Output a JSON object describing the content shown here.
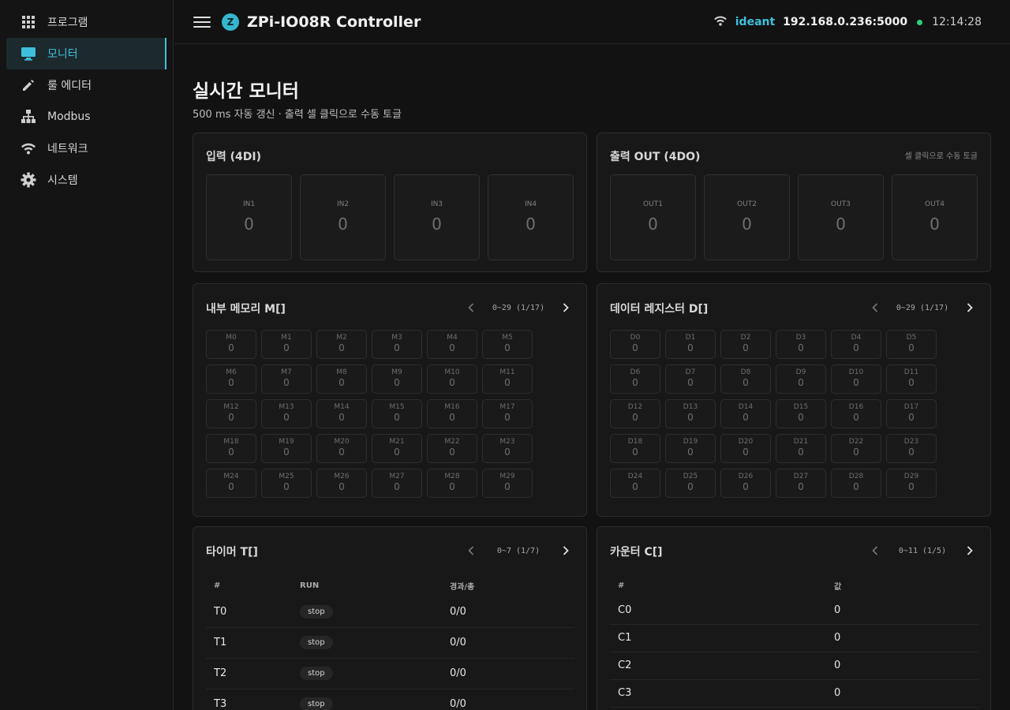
{
  "sidebar": {
    "items": [
      {
        "label": "프로그램",
        "icon": "apps-grid-icon"
      },
      {
        "label": "모니터",
        "icon": "monitor-icon",
        "active": true
      },
      {
        "label": "룰 에디터",
        "icon": "pencil-icon"
      },
      {
        "label": "Modbus",
        "icon": "network-tree-icon"
      },
      {
        "label": "네트워크",
        "icon": "wifi-icon"
      },
      {
        "label": "시스템",
        "icon": "gear-icon"
      }
    ]
  },
  "header": {
    "logo_letter": "Z",
    "title": "ZPi-IO08R Controller",
    "user": "ideant",
    "address": "192.168.0.236:5000",
    "time": "12:14:28",
    "status_color": "#2ed27a",
    "accent": "#3ec0dc"
  },
  "page": {
    "title": "실시간 모니터",
    "subtitle": "500 ms 자동 갱신 · 출력 셀 클릭으로 수동 토글"
  },
  "inputs": {
    "title": "입력 (4DI)",
    "cells": [
      {
        "label": "IN1",
        "value": "0"
      },
      {
        "label": "IN2",
        "value": "0"
      },
      {
        "label": "IN3",
        "value": "0"
      },
      {
        "label": "IN4",
        "value": "0"
      }
    ]
  },
  "outputs": {
    "title": "출력 OUT (4DO)",
    "hint": "셀 클릭으로 수동 토글",
    "cells": [
      {
        "label": "OUT1",
        "value": "0"
      },
      {
        "label": "OUT2",
        "value": "0"
      },
      {
        "label": "OUT3",
        "value": "0"
      },
      {
        "label": "OUT4",
        "value": "0"
      }
    ]
  },
  "memory": {
    "title": "내부 메모리 M[]",
    "range": "0~29 (1/17)",
    "cells": [
      {
        "label": "M0",
        "value": "0"
      },
      {
        "label": "M1",
        "value": "0"
      },
      {
        "label": "M2",
        "value": "0"
      },
      {
        "label": "M3",
        "value": "0"
      },
      {
        "label": "M4",
        "value": "0"
      },
      {
        "label": "M5",
        "value": "0"
      },
      {
        "label": "M6",
        "value": "0"
      },
      {
        "label": "M7",
        "value": "0"
      },
      {
        "label": "M8",
        "value": "0"
      },
      {
        "label": "M9",
        "value": "0"
      },
      {
        "label": "M10",
        "value": "0"
      },
      {
        "label": "M11",
        "value": "0"
      },
      {
        "label": "M12",
        "value": "0"
      },
      {
        "label": "M13",
        "value": "0"
      },
      {
        "label": "M14",
        "value": "0"
      },
      {
        "label": "M15",
        "value": "0"
      },
      {
        "label": "M16",
        "value": "0"
      },
      {
        "label": "M17",
        "value": "0"
      },
      {
        "label": "M18",
        "value": "0"
      },
      {
        "label": "M19",
        "value": "0"
      },
      {
        "label": "M20",
        "value": "0"
      },
      {
        "label": "M21",
        "value": "0"
      },
      {
        "label": "M22",
        "value": "0"
      },
      {
        "label": "M23",
        "value": "0"
      },
      {
        "label": "M24",
        "value": "0"
      },
      {
        "label": "M25",
        "value": "0"
      },
      {
        "label": "M26",
        "value": "0"
      },
      {
        "label": "M27",
        "value": "0"
      },
      {
        "label": "M28",
        "value": "0"
      },
      {
        "label": "M29",
        "value": "0"
      }
    ]
  },
  "registers": {
    "title": "데이터 레지스터 D[]",
    "range": "0~29 (1/17)",
    "cells": [
      {
        "label": "D0",
        "value": "0"
      },
      {
        "label": "D1",
        "value": "0"
      },
      {
        "label": "D2",
        "value": "0"
      },
      {
        "label": "D3",
        "value": "0"
      },
      {
        "label": "D4",
        "value": "0"
      },
      {
        "label": "D5",
        "value": "0"
      },
      {
        "label": "D6",
        "value": "0"
      },
      {
        "label": "D7",
        "value": "0"
      },
      {
        "label": "D8",
        "value": "0"
      },
      {
        "label": "D9",
        "value": "0"
      },
      {
        "label": "D10",
        "value": "0"
      },
      {
        "label": "D11",
        "value": "0"
      },
      {
        "label": "D12",
        "value": "0"
      },
      {
        "label": "D13",
        "value": "0"
      },
      {
        "label": "D14",
        "value": "0"
      },
      {
        "label": "D15",
        "value": "0"
      },
      {
        "label": "D16",
        "value": "0"
      },
      {
        "label": "D17",
        "value": "0"
      },
      {
        "label": "D18",
        "value": "0"
      },
      {
        "label": "D19",
        "value": "0"
      },
      {
        "label": "D20",
        "value": "0"
      },
      {
        "label": "D21",
        "value": "0"
      },
      {
        "label": "D22",
        "value": "0"
      },
      {
        "label": "D23",
        "value": "0"
      },
      {
        "label": "D24",
        "value": "0"
      },
      {
        "label": "D25",
        "value": "0"
      },
      {
        "label": "D26",
        "value": "0"
      },
      {
        "label": "D27",
        "value": "0"
      },
      {
        "label": "D28",
        "value": "0"
      },
      {
        "label": "D29",
        "value": "0"
      }
    ]
  },
  "timers": {
    "title": "타이머 T[]",
    "range": "0~7 (1/7)",
    "columns": [
      "#",
      "RUN",
      "경과/총"
    ],
    "rows": [
      {
        "id": "T0",
        "run": "stop",
        "elapsed": "0/0"
      },
      {
        "id": "T1",
        "run": "stop",
        "elapsed": "0/0"
      },
      {
        "id": "T2",
        "run": "stop",
        "elapsed": "0/0"
      },
      {
        "id": "T3",
        "run": "stop",
        "elapsed": "0/0"
      }
    ]
  },
  "counters": {
    "title": "카운터 C[]",
    "range": "0~11 (1/5)",
    "columns": [
      "#",
      "값"
    ],
    "rows": [
      {
        "id": "C0",
        "value": "0"
      },
      {
        "id": "C1",
        "value": "0"
      },
      {
        "id": "C2",
        "value": "0"
      },
      {
        "id": "C3",
        "value": "0"
      }
    ]
  }
}
